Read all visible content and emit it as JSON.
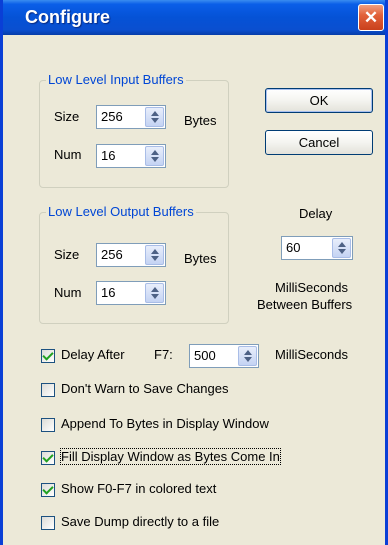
{
  "window": {
    "title": "Configure",
    "close_glyph": "✕"
  },
  "input_group": {
    "legend": "Low Level Input Buffers",
    "size_label": "Size",
    "size_value": "256",
    "bytes_label": "Bytes",
    "num_label": "Num",
    "num_value": "16"
  },
  "output_group": {
    "legend": "Low Level Output Buffers",
    "size_label": "Size",
    "size_value": "256",
    "bytes_label": "Bytes",
    "num_label": "Num",
    "num_value": "16"
  },
  "buttons": {
    "ok": "OK",
    "cancel": "Cancel"
  },
  "delay": {
    "label": "Delay",
    "value": "60",
    "unit_line1": "MilliSeconds",
    "unit_line2": "Between Buffers"
  },
  "options": {
    "delay_after_label": "Delay After",
    "delay_after_key": "F7:",
    "delay_after_value": "500",
    "delay_after_unit": "MilliSeconds",
    "items": [
      {
        "label": "Delay After",
        "checked": true
      },
      {
        "label": "Don't Warn to Save Changes",
        "checked": false
      },
      {
        "label": "Append To Bytes in Display Window",
        "checked": false
      },
      {
        "label": "Fill Display Window as Bytes Come In",
        "checked": true
      },
      {
        "label": "Show F0-F7 in colored text",
        "checked": true
      },
      {
        "label": "Save Dump directly to a file",
        "checked": false
      }
    ]
  },
  "icons": {
    "close": "close-icon",
    "spin_up": "arrow-up-icon",
    "spin_down": "arrow-down-icon",
    "checkmark": "checkmark-icon"
  }
}
